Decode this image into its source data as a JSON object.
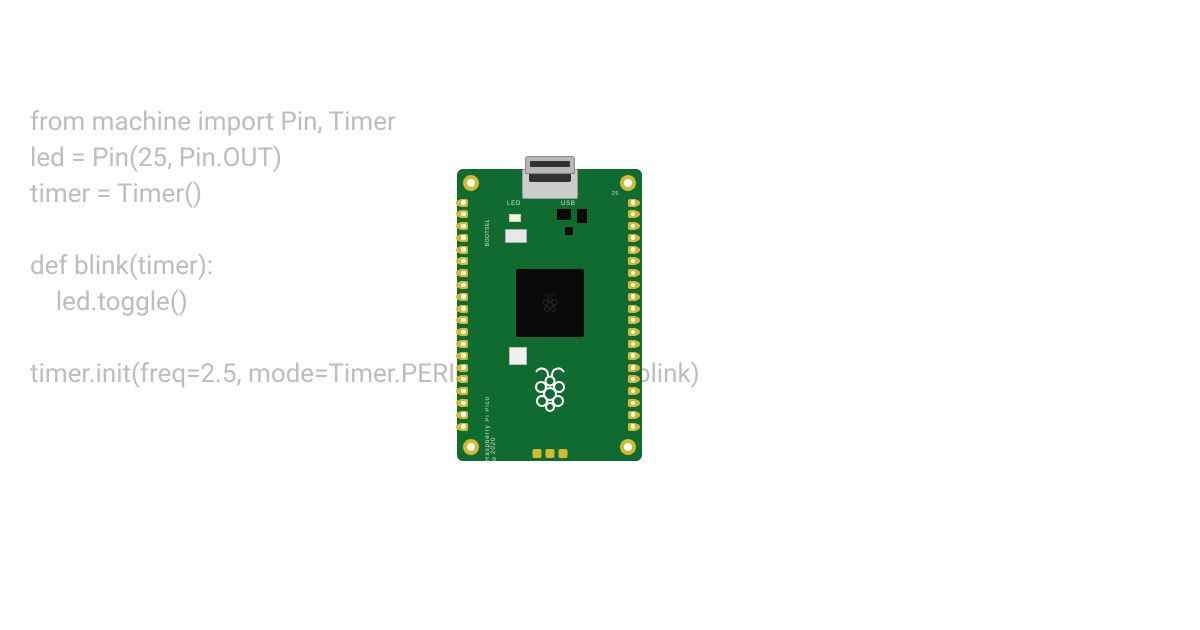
{
  "code": {
    "line1": "from machine import Pin, Timer",
    "line2": "led = Pin(25, Pin.OUT)",
    "line3": "timer = Timer()",
    "line4": "",
    "line5": "def blink(timer):",
    "line6": "    led.toggle()",
    "line7": "",
    "line8": "timer.init(freq=2.5, mode=Timer.PERIODIC, callback=blink)"
  },
  "board": {
    "name": "Raspberry Pi Pico",
    "copyright_text": "Raspberry Pi Pico ©2020",
    "labels": {
      "led": "LED",
      "usb": "USB",
      "pin25": "25",
      "bootsel": "BOOTSEL"
    },
    "pin_count_per_side": 20,
    "debug_pad_count": 3,
    "colors": {
      "pcb": "#0f6b2f",
      "pad": "#d4b830",
      "chip": "#0a0a0a",
      "silkscreen": "#ffffff"
    }
  }
}
